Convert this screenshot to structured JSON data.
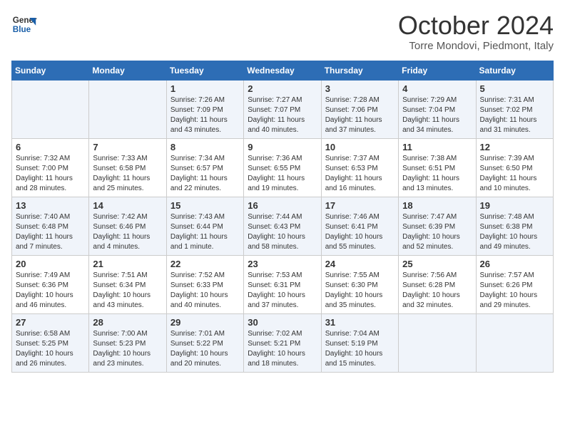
{
  "logo": {
    "line1": "General",
    "line2": "Blue"
  },
  "title": "October 2024",
  "subtitle": "Torre Mondovi, Piedmont, Italy",
  "days_of_week": [
    "Sunday",
    "Monday",
    "Tuesday",
    "Wednesday",
    "Thursday",
    "Friday",
    "Saturday"
  ],
  "weeks": [
    [
      {
        "day": "",
        "sunrise": "",
        "sunset": "",
        "daylight": ""
      },
      {
        "day": "",
        "sunrise": "",
        "sunset": "",
        "daylight": ""
      },
      {
        "day": "1",
        "sunrise": "Sunrise: 7:26 AM",
        "sunset": "Sunset: 7:09 PM",
        "daylight": "Daylight: 11 hours and 43 minutes."
      },
      {
        "day": "2",
        "sunrise": "Sunrise: 7:27 AM",
        "sunset": "Sunset: 7:07 PM",
        "daylight": "Daylight: 11 hours and 40 minutes."
      },
      {
        "day": "3",
        "sunrise": "Sunrise: 7:28 AM",
        "sunset": "Sunset: 7:06 PM",
        "daylight": "Daylight: 11 hours and 37 minutes."
      },
      {
        "day": "4",
        "sunrise": "Sunrise: 7:29 AM",
        "sunset": "Sunset: 7:04 PM",
        "daylight": "Daylight: 11 hours and 34 minutes."
      },
      {
        "day": "5",
        "sunrise": "Sunrise: 7:31 AM",
        "sunset": "Sunset: 7:02 PM",
        "daylight": "Daylight: 11 hours and 31 minutes."
      }
    ],
    [
      {
        "day": "6",
        "sunrise": "Sunrise: 7:32 AM",
        "sunset": "Sunset: 7:00 PM",
        "daylight": "Daylight: 11 hours and 28 minutes."
      },
      {
        "day": "7",
        "sunrise": "Sunrise: 7:33 AM",
        "sunset": "Sunset: 6:58 PM",
        "daylight": "Daylight: 11 hours and 25 minutes."
      },
      {
        "day": "8",
        "sunrise": "Sunrise: 7:34 AM",
        "sunset": "Sunset: 6:57 PM",
        "daylight": "Daylight: 11 hours and 22 minutes."
      },
      {
        "day": "9",
        "sunrise": "Sunrise: 7:36 AM",
        "sunset": "Sunset: 6:55 PM",
        "daylight": "Daylight: 11 hours and 19 minutes."
      },
      {
        "day": "10",
        "sunrise": "Sunrise: 7:37 AM",
        "sunset": "Sunset: 6:53 PM",
        "daylight": "Daylight: 11 hours and 16 minutes."
      },
      {
        "day": "11",
        "sunrise": "Sunrise: 7:38 AM",
        "sunset": "Sunset: 6:51 PM",
        "daylight": "Daylight: 11 hours and 13 minutes."
      },
      {
        "day": "12",
        "sunrise": "Sunrise: 7:39 AM",
        "sunset": "Sunset: 6:50 PM",
        "daylight": "Daylight: 11 hours and 10 minutes."
      }
    ],
    [
      {
        "day": "13",
        "sunrise": "Sunrise: 7:40 AM",
        "sunset": "Sunset: 6:48 PM",
        "daylight": "Daylight: 11 hours and 7 minutes."
      },
      {
        "day": "14",
        "sunrise": "Sunrise: 7:42 AM",
        "sunset": "Sunset: 6:46 PM",
        "daylight": "Daylight: 11 hours and 4 minutes."
      },
      {
        "day": "15",
        "sunrise": "Sunrise: 7:43 AM",
        "sunset": "Sunset: 6:44 PM",
        "daylight": "Daylight: 11 hours and 1 minute."
      },
      {
        "day": "16",
        "sunrise": "Sunrise: 7:44 AM",
        "sunset": "Sunset: 6:43 PM",
        "daylight": "Daylight: 10 hours and 58 minutes."
      },
      {
        "day": "17",
        "sunrise": "Sunrise: 7:46 AM",
        "sunset": "Sunset: 6:41 PM",
        "daylight": "Daylight: 10 hours and 55 minutes."
      },
      {
        "day": "18",
        "sunrise": "Sunrise: 7:47 AM",
        "sunset": "Sunset: 6:39 PM",
        "daylight": "Daylight: 10 hours and 52 minutes."
      },
      {
        "day": "19",
        "sunrise": "Sunrise: 7:48 AM",
        "sunset": "Sunset: 6:38 PM",
        "daylight": "Daylight: 10 hours and 49 minutes."
      }
    ],
    [
      {
        "day": "20",
        "sunrise": "Sunrise: 7:49 AM",
        "sunset": "Sunset: 6:36 PM",
        "daylight": "Daylight: 10 hours and 46 minutes."
      },
      {
        "day": "21",
        "sunrise": "Sunrise: 7:51 AM",
        "sunset": "Sunset: 6:34 PM",
        "daylight": "Daylight: 10 hours and 43 minutes."
      },
      {
        "day": "22",
        "sunrise": "Sunrise: 7:52 AM",
        "sunset": "Sunset: 6:33 PM",
        "daylight": "Daylight: 10 hours and 40 minutes."
      },
      {
        "day": "23",
        "sunrise": "Sunrise: 7:53 AM",
        "sunset": "Sunset: 6:31 PM",
        "daylight": "Daylight: 10 hours and 37 minutes."
      },
      {
        "day": "24",
        "sunrise": "Sunrise: 7:55 AM",
        "sunset": "Sunset: 6:30 PM",
        "daylight": "Daylight: 10 hours and 35 minutes."
      },
      {
        "day": "25",
        "sunrise": "Sunrise: 7:56 AM",
        "sunset": "Sunset: 6:28 PM",
        "daylight": "Daylight: 10 hours and 32 minutes."
      },
      {
        "day": "26",
        "sunrise": "Sunrise: 7:57 AM",
        "sunset": "Sunset: 6:26 PM",
        "daylight": "Daylight: 10 hours and 29 minutes."
      }
    ],
    [
      {
        "day": "27",
        "sunrise": "Sunrise: 6:58 AM",
        "sunset": "Sunset: 5:25 PM",
        "daylight": "Daylight: 10 hours and 26 minutes."
      },
      {
        "day": "28",
        "sunrise": "Sunrise: 7:00 AM",
        "sunset": "Sunset: 5:23 PM",
        "daylight": "Daylight: 10 hours and 23 minutes."
      },
      {
        "day": "29",
        "sunrise": "Sunrise: 7:01 AM",
        "sunset": "Sunset: 5:22 PM",
        "daylight": "Daylight: 10 hours and 20 minutes."
      },
      {
        "day": "30",
        "sunrise": "Sunrise: 7:02 AM",
        "sunset": "Sunset: 5:21 PM",
        "daylight": "Daylight: 10 hours and 18 minutes."
      },
      {
        "day": "31",
        "sunrise": "Sunrise: 7:04 AM",
        "sunset": "Sunset: 5:19 PM",
        "daylight": "Daylight: 10 hours and 15 minutes."
      },
      {
        "day": "",
        "sunrise": "",
        "sunset": "",
        "daylight": ""
      },
      {
        "day": "",
        "sunrise": "",
        "sunset": "",
        "daylight": ""
      }
    ]
  ]
}
